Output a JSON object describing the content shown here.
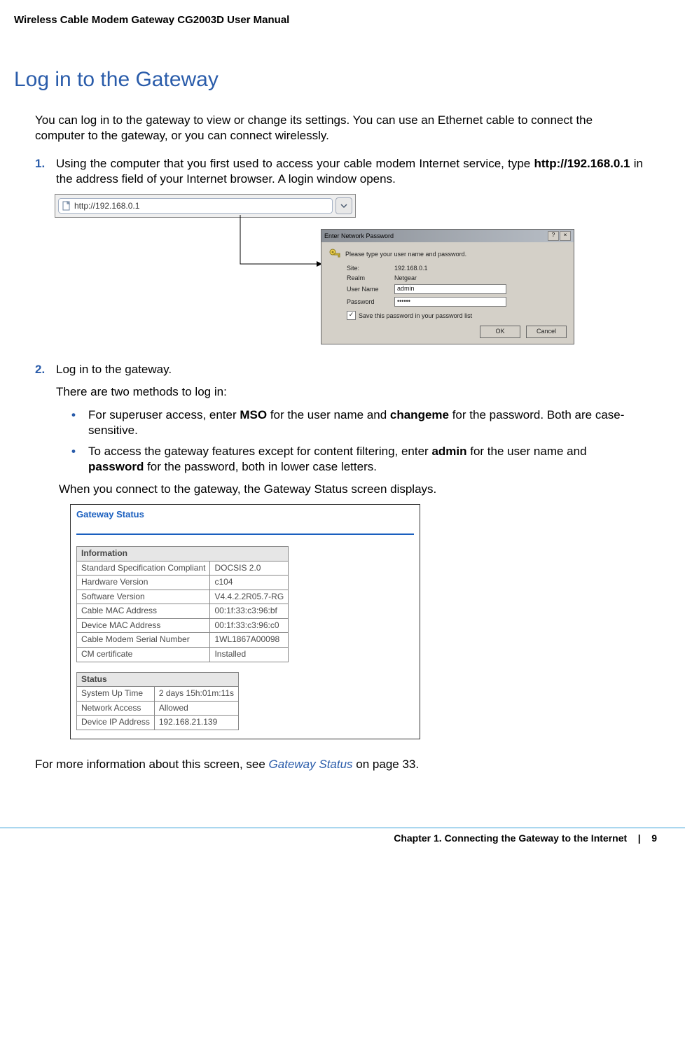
{
  "header": {
    "title": "Wireless Cable Modem Gateway CG2003D User Manual"
  },
  "h1": "Log in to the Gateway",
  "intro": "You can log in to the gateway to view or change its settings. You can use an Ethernet cable to connect the computer to the gateway, or you can connect wirelessly.",
  "steps": {
    "one": {
      "num": "1.",
      "text_a": "Using the computer that you first used to access your cable modem Internet service, type ",
      "bold": "http://192.168.0.1",
      "text_b": " in the address field of your Internet browser. A login window opens."
    },
    "two": {
      "num": "2.",
      "text": "Log in to the gateway.",
      "subtext": "There are two methods to log in:",
      "bullets": {
        "b1_a": "For superuser access, enter ",
        "b1_bold1": "MSO",
        "b1_b": " for the user name and ",
        "b1_bold2": "changeme",
        "b1_c": " for the password. Both are case-sensitive.",
        "b2_a": "To access the gateway features except for content filtering, enter ",
        "b2_bold1": "admin",
        "b2_b": " for the user name and ",
        "b2_bold2": "password",
        "b2_c": " for the password, both in lower case letters."
      },
      "after_bullets": "When you connect to the gateway, the Gateway Status screen displays."
    }
  },
  "addressbar": {
    "url": "http://192.168.0.1"
  },
  "dialog": {
    "title": "Enter Network Password",
    "prompt": "Please type your user name and password.",
    "labels": {
      "site": "Site:",
      "realm": "Realm",
      "user": "User Name",
      "pass": "Password"
    },
    "values": {
      "site": "192.168.0.1",
      "realm": "Netgear",
      "user": "admin",
      "pass": "••••••"
    },
    "checkbox": "Save this password in your password list",
    "ok": "OK",
    "cancel": "Cancel"
  },
  "gateway_status": {
    "title": "Gateway Status",
    "info_heading": "Information",
    "info_rows": [
      [
        "Standard Specification Compliant",
        "DOCSIS 2.0"
      ],
      [
        "Hardware Version",
        "c104"
      ],
      [
        "Software Version",
        "V4.4.2.2R05.7-RG"
      ],
      [
        "Cable MAC Address",
        "00:1f:33:c3:96:bf"
      ],
      [
        "Device MAC Address",
        "00:1f:33:c3:96:c0"
      ],
      [
        "Cable Modem Serial Number",
        "1WL1867A00098"
      ],
      [
        "CM certificate",
        "Installed"
      ]
    ],
    "status_heading": "Status",
    "status_rows": [
      [
        "System Up Time",
        "2 days 15h:01m:11s"
      ],
      [
        "Network Access",
        "Allowed"
      ],
      [
        "Device IP Address",
        "192.168.21.139"
      ]
    ]
  },
  "closing": {
    "pre": "For more information about this screen, see ",
    "link": "Gateway Status",
    "post": " on page 33."
  },
  "footer": {
    "left": "Chapter 1.  Connecting the Gateway to the Internet",
    "sep": "|",
    "page": "9"
  }
}
